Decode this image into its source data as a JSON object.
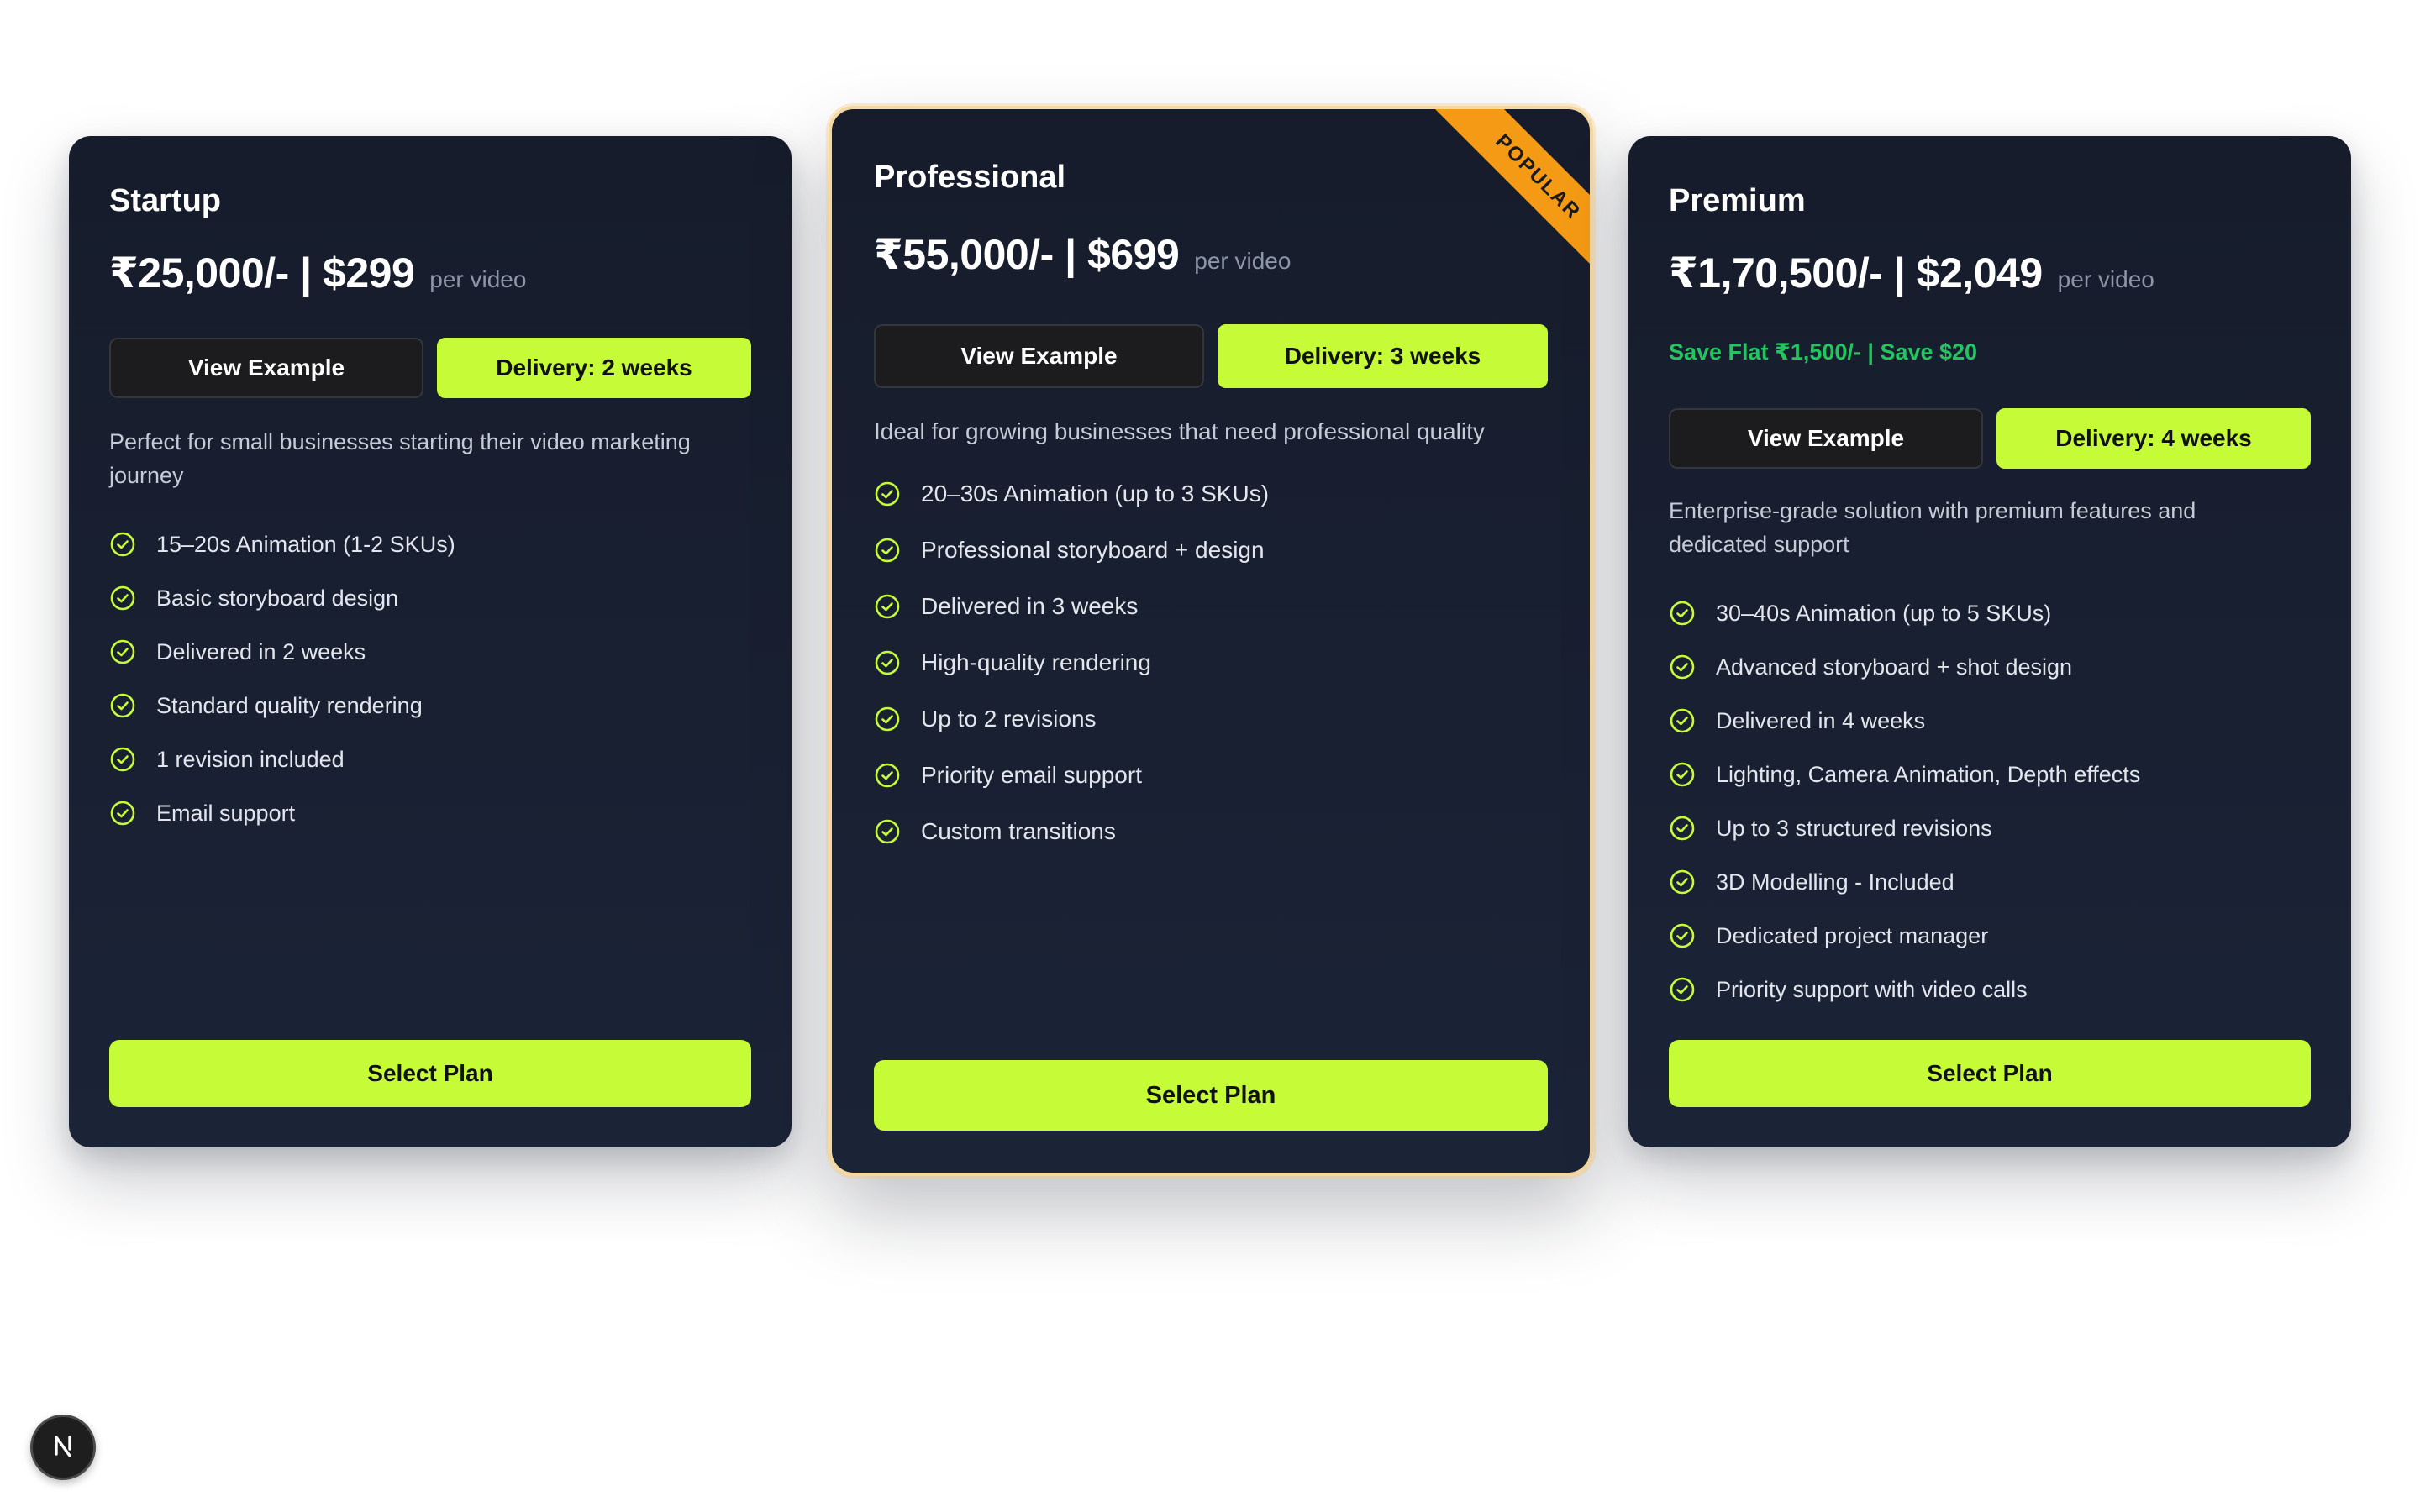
{
  "colors": {
    "card_bg": "#161c2b",
    "accent_lime": "#c6fb38",
    "save_green": "#22c55e",
    "popular_ribbon": "#f59a14",
    "popular_border": "#f4d8a2"
  },
  "plans": [
    {
      "name": "Startup",
      "price": "₹25,000/- | $299",
      "per": "per video",
      "view_example": "View Example",
      "delivery": "Delivery: 2 weeks",
      "description": "Perfect for small businesses starting their video marketing journey",
      "features": [
        "15–20s Animation (1-2 SKUs)",
        "Basic storyboard design",
        "Delivered in 2 weeks",
        "Standard quality rendering",
        "1 revision included",
        "Email support"
      ],
      "select": "Select Plan"
    },
    {
      "name": "Professional",
      "badge": "POPULAR",
      "price": "₹55,000/- | $699",
      "per": "per video",
      "view_example": "View Example",
      "delivery": "Delivery: 3 weeks",
      "description": "Ideal for growing businesses that need professional quality",
      "features": [
        "20–30s Animation (up to 3 SKUs)",
        "Professional storyboard + design",
        "Delivered in 3 weeks",
        "High-quality rendering",
        "Up to 2 revisions",
        "Priority email support",
        "Custom transitions"
      ],
      "select": "Select Plan"
    },
    {
      "name": "Premium",
      "price": "₹1,70,500/- | $2,049",
      "per": "per video",
      "save": "Save Flat ₹1,500/- | Save $20",
      "view_example": "View Example",
      "delivery": "Delivery: 4 weeks",
      "description": "Enterprise-grade solution with premium features and dedicated support",
      "features": [
        "30–40s Animation (up to 5 SKUs)",
        "Advanced storyboard + shot design",
        "Delivered in 4 weeks",
        "Lighting, Camera Animation, Depth effects",
        "Up to 3 structured revisions",
        "3D Modelling - Included",
        "Dedicated project manager",
        "Priority support with video calls"
      ],
      "select": "Select Plan"
    }
  ],
  "dev_badge": {
    "letter": "N",
    "icon": "nextjs-icon"
  }
}
